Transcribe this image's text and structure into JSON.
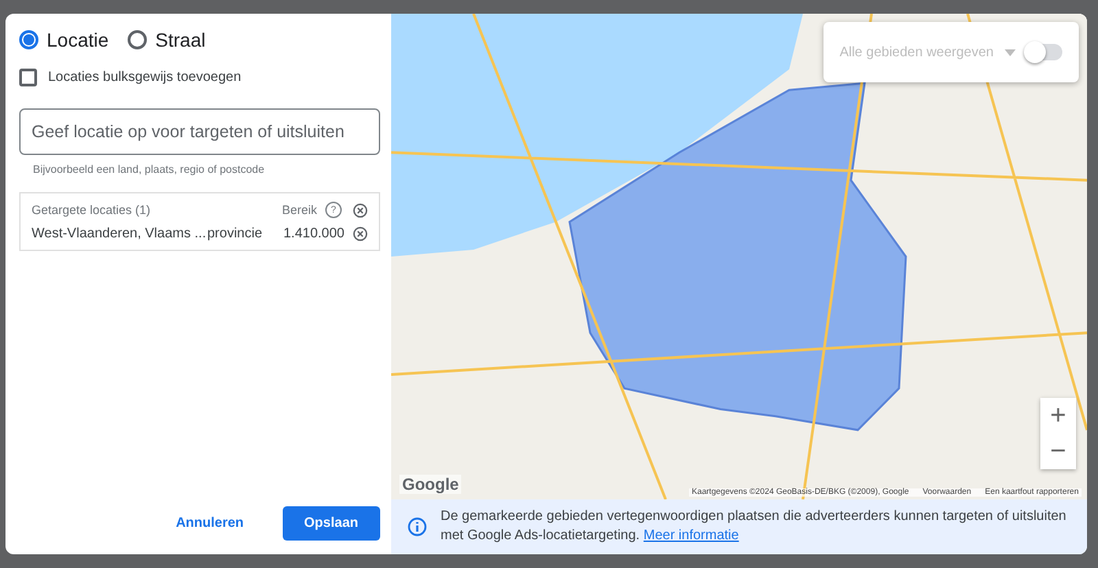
{
  "mode_options": [
    {
      "label": "Locatie",
      "selected": true
    },
    {
      "label": "Straal",
      "selected": false
    }
  ],
  "bulk_add": {
    "label": "Locaties bulksgewijs toevoegen",
    "checked": false
  },
  "search": {
    "placeholder": "Geef locatie op voor targeten of uitsluiten",
    "hint": "Bijvoorbeeld een land, plaats, regio of postcode"
  },
  "targeted": {
    "title": "Getargete locaties (1)",
    "reach_label": "Bereik",
    "help": "?",
    "rows": [
      {
        "name": "West-Vlaanderen, Vlaams ...",
        "type": "provincie",
        "reach": "1.410.000"
      }
    ]
  },
  "buttons": {
    "cancel": "Annuleren",
    "save": "Opslaan"
  },
  "map": {
    "overlay": {
      "label": "Alle gebieden weergeven",
      "on": false
    },
    "zoom": [
      "+",
      "−"
    ],
    "logo": "Google",
    "attribution": [
      "Kaartgegevens ©2024 GeoBasis-DE/BKG (©2009), Google",
      "Voorwaarden",
      "Een kaartfout rapporteren"
    ]
  },
  "info": {
    "text": "De gemarkeerde gebieden vertegenwoordigen plaatsen die adverteerders kunnen targeten of uitsluiten met Google Ads-locatietargeting.",
    "link": "Meer informatie"
  }
}
